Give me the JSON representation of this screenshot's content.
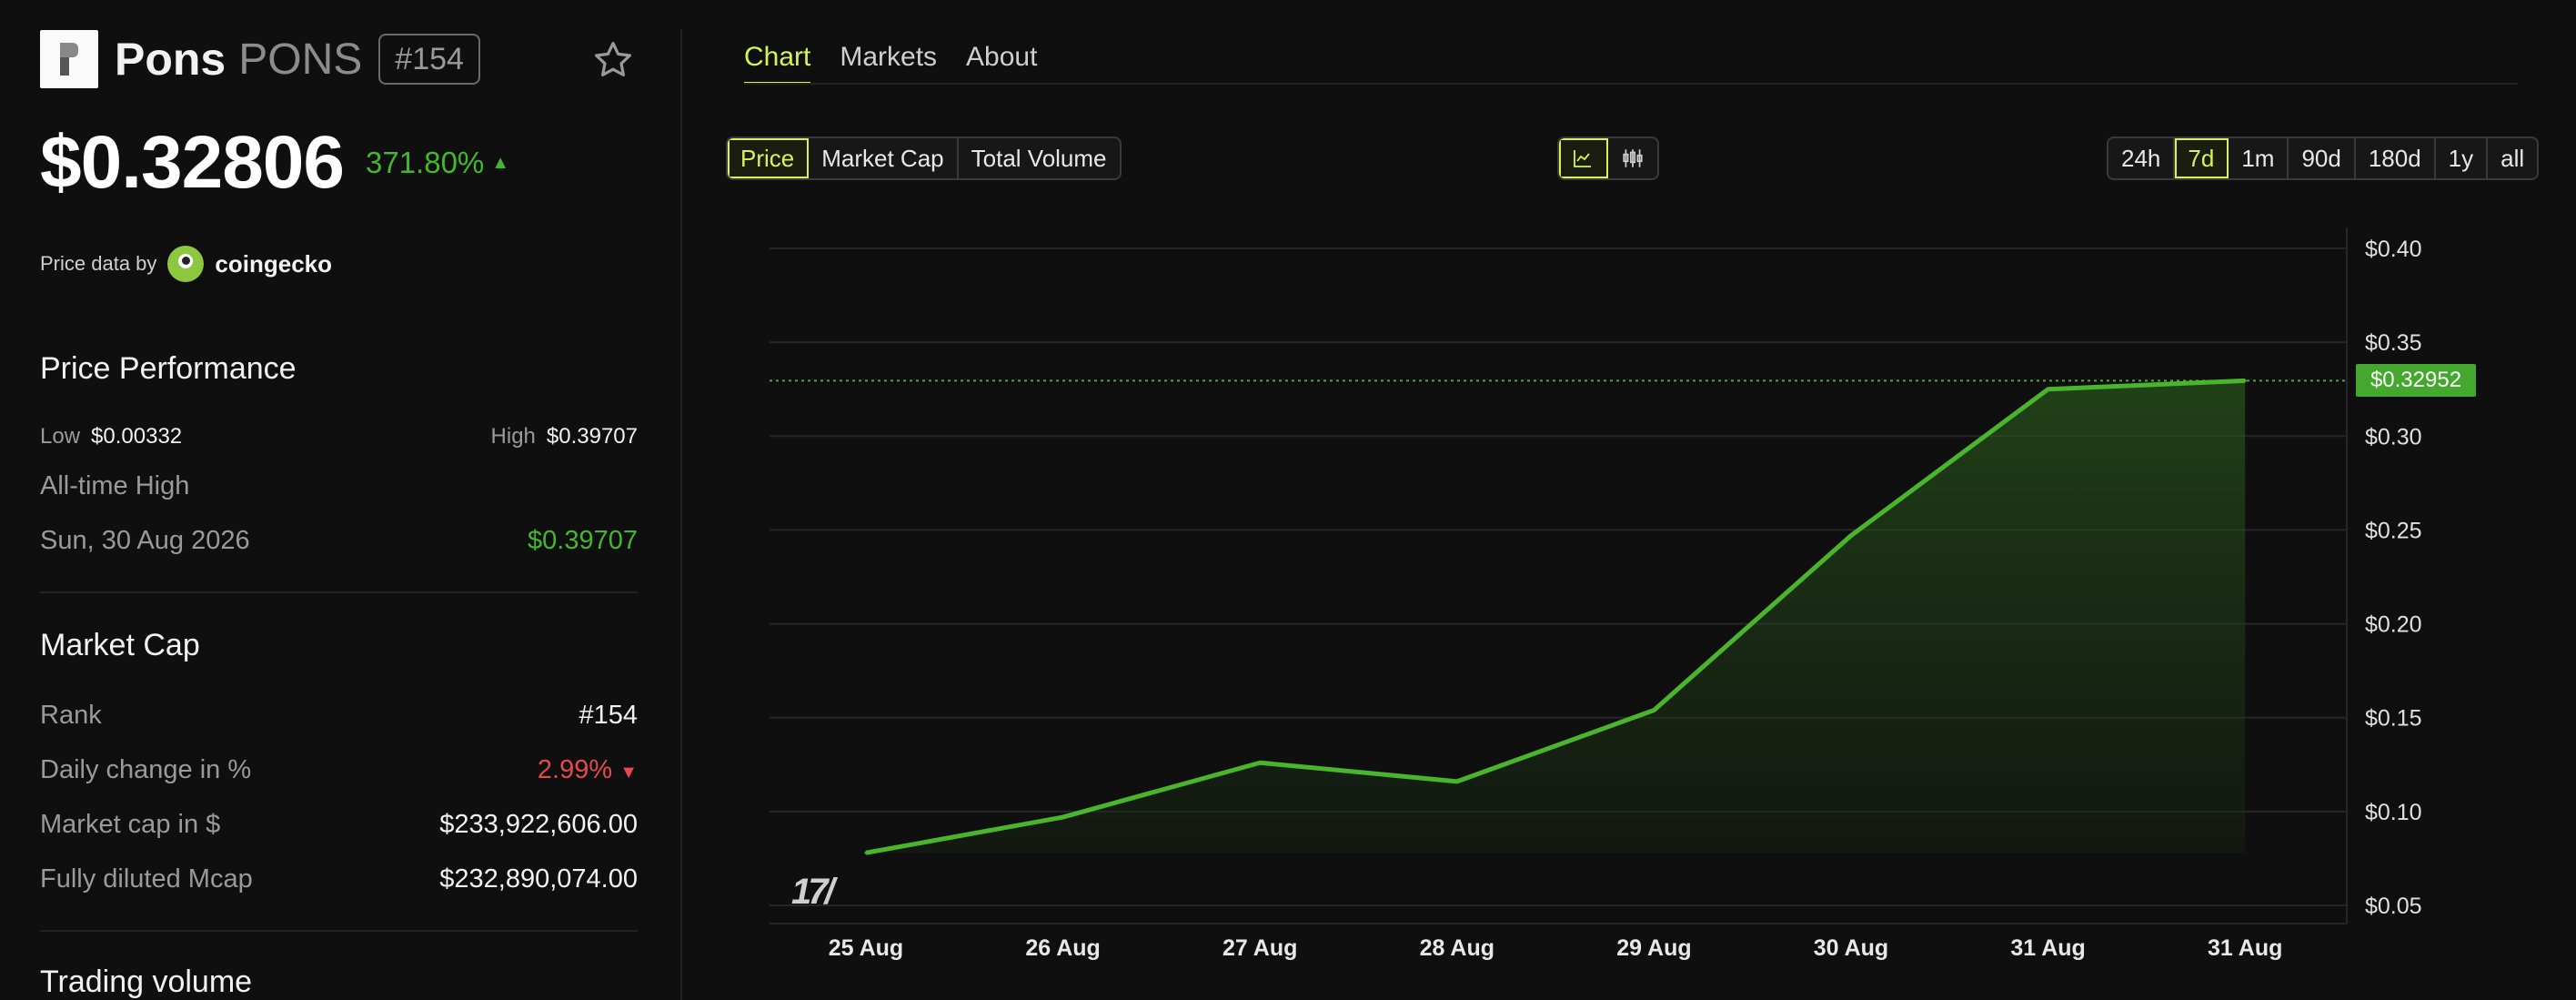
{
  "coin": {
    "name": "Pons",
    "symbol": "PONS",
    "rank_chip": "#154",
    "price": "$0.32806",
    "change_pct": "371.80%",
    "price_data_label": "Price data by",
    "provider": "coingecko"
  },
  "performance": {
    "title": "Price Performance",
    "low_label": "Low",
    "low_value": "$0.00332",
    "high_label": "High",
    "high_value": "$0.39707",
    "ath_label": "All-time High",
    "ath_date": "Sun, 30 Aug 2026",
    "ath_value": "$0.39707"
  },
  "market_cap": {
    "title": "Market Cap",
    "rows": [
      {
        "label": "Rank",
        "value": "#154"
      },
      {
        "label": "Daily change in %",
        "value": "2.99%"
      },
      {
        "label": "Market cap in $",
        "value": "$233,922,606.00"
      },
      {
        "label": "Fully diluted Mcap",
        "value": "$232,890,074.00"
      }
    ]
  },
  "trading_volume": {
    "title": "Trading volume"
  },
  "tabs": [
    "Chart",
    "Markets",
    "About"
  ],
  "metric_buttons": [
    "Price",
    "Market Cap",
    "Total Volume"
  ],
  "range_buttons": [
    "24h",
    "7d",
    "1m",
    "90d",
    "180d",
    "1y",
    "all"
  ],
  "icons": {
    "line_chart": "line-chart-icon",
    "candles": "candlestick-icon",
    "star": "star-icon"
  },
  "colors": {
    "accent": "#d6f45a",
    "up": "#45b62f",
    "down": "#e5484d"
  },
  "chart_data": {
    "type": "area",
    "x": [
      "25 Aug",
      "26 Aug",
      "27 Aug",
      "28 Aug",
      "29 Aug",
      "30 Aug",
      "31 Aug",
      "31 Aug"
    ],
    "y": [
      0.078,
      0.097,
      0.126,
      0.116,
      0.154,
      0.247,
      0.325,
      0.3295
    ],
    "y_ticks": [
      "$0.05",
      "$0.10",
      "$0.15",
      "$0.20",
      "$0.25",
      "$0.30",
      "$0.35",
      "$0.40"
    ],
    "ylim": [
      0.05,
      0.4
    ],
    "last_price_label": "$0.32952",
    "last_price": 0.32952,
    "grid": true
  }
}
